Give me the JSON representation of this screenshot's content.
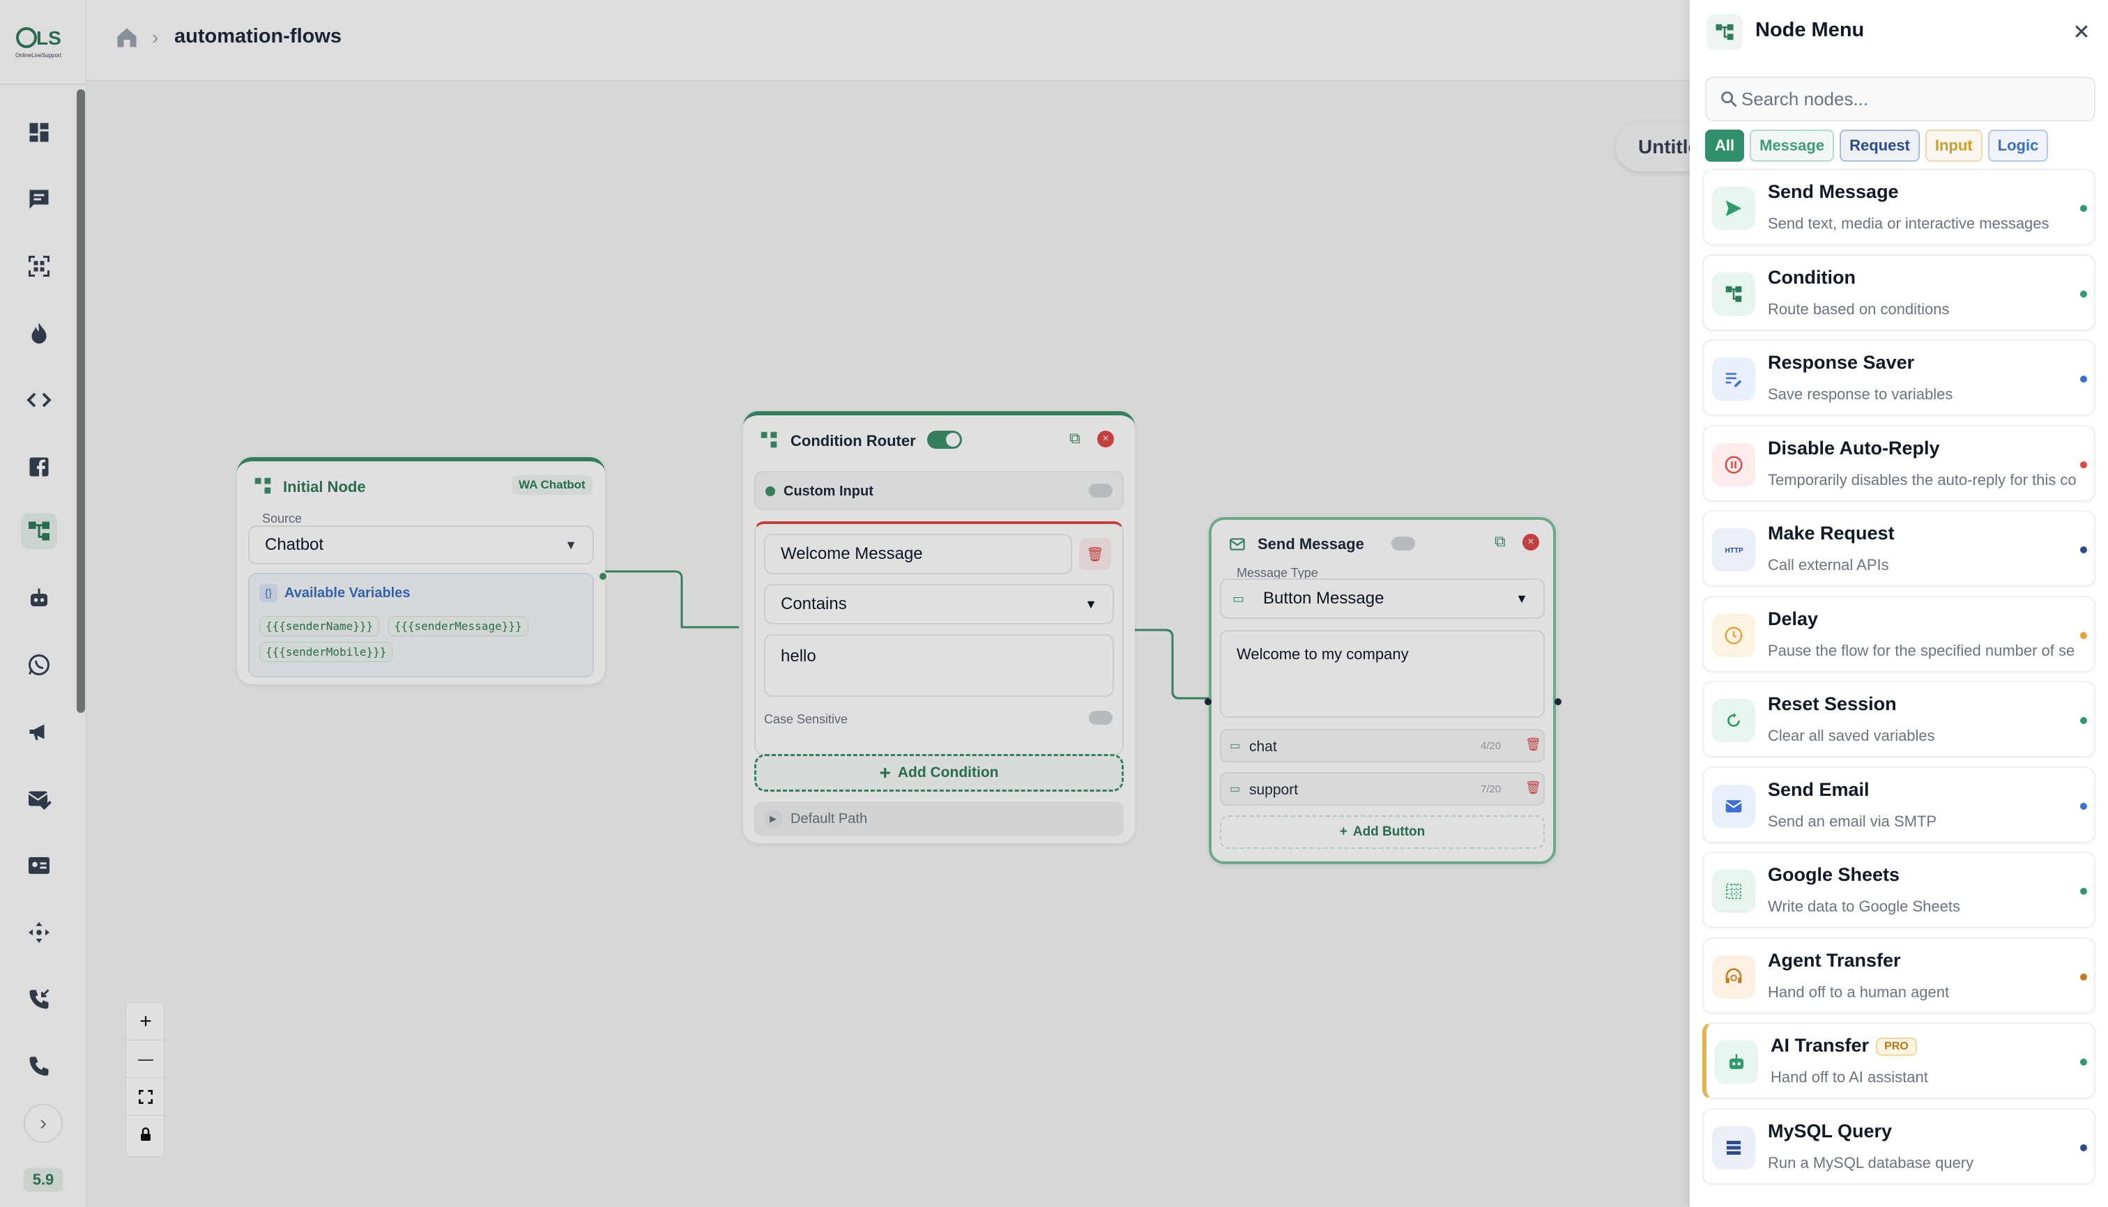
{
  "app": {
    "version": "5.9",
    "logo_text": "OLS",
    "logo_subtext": "OnlineLiveSupport"
  },
  "breadcrumb": {
    "current": "automation-flows"
  },
  "flow": {
    "name": "Untitled"
  },
  "canvas": {
    "initial_node": {
      "title": "Initial Node",
      "badge": "WA Chatbot",
      "source_label": "Source",
      "source_value": "Chatbot",
      "variables_title": "Available Variables",
      "variables": [
        "{{{senderName}}}",
        "{{{senderMessage}}}",
        "{{{senderMobile}}}"
      ]
    },
    "condition_router": {
      "title": "Condition Router",
      "custom_input_label": "Custom Input",
      "condition_field": "Welcome Message",
      "operator": "Contains",
      "value": "hello",
      "case_sensitive_label": "Case Sensitive",
      "add_condition_label": "Add Condition",
      "default_path_label": "Default Path"
    },
    "send_message": {
      "title": "Send Message",
      "message_type_label": "Message Type",
      "message_type_value": "Button Message",
      "message_text": "Welcome to my company",
      "buttons": [
        {
          "label": "chat",
          "count": "4/20"
        },
        {
          "label": "support",
          "count": "7/20"
        }
      ],
      "add_button_label": "Add Button"
    }
  },
  "zoom_controls": {
    "zoom_in": "+",
    "zoom_out": "—"
  },
  "node_menu": {
    "title": "Node Menu",
    "search_placeholder": "Search nodes...",
    "filters": [
      {
        "label": "All",
        "color": "#2f8f6a"
      },
      {
        "label": "Message",
        "color": "#3f9c76"
      },
      {
        "label": "Request",
        "color": "#2b4a8f"
      },
      {
        "label": "Input",
        "color": "#d19a2c"
      },
      {
        "label": "Logic",
        "color": "#3b6fc4"
      }
    ],
    "items": [
      {
        "title": "Send Message",
        "desc": "Send text, media or interactive messages",
        "icon": "send-icon",
        "dot": "#2f9a6a"
      },
      {
        "title": "Condition",
        "desc": "Route based on conditions",
        "icon": "branch-icon",
        "dot": "#2f9a6a"
      },
      {
        "title": "Response Saver",
        "desc": "Save response to variables",
        "icon": "edit-list-icon",
        "dot": "#3b6fd4"
      },
      {
        "title": "Disable Auto-Reply",
        "desc": "Temporarily disables the auto-reply for this co",
        "icon": "pause-icon",
        "dot": "#e04848"
      },
      {
        "title": "Make Request",
        "desc": "Call external APIs",
        "icon": "http-icon",
        "dot": "#2b4a8f"
      },
      {
        "title": "Delay",
        "desc": "Pause the flow for the specified number of se",
        "icon": "clock-icon",
        "dot": "#e6a23c"
      },
      {
        "title": "Reset Session",
        "desc": "Clear all saved variables",
        "icon": "reset-icon",
        "dot": "#2f9a6a"
      },
      {
        "title": "Send Email",
        "desc": "Send an email via SMTP",
        "icon": "mail-icon",
        "dot": "#3b6fd4"
      },
      {
        "title": "Google Sheets",
        "desc": "Write data to Google Sheets",
        "icon": "sheet-icon",
        "dot": "#2f9a6a"
      },
      {
        "title": "Agent Transfer",
        "desc": "Hand off to a human agent",
        "icon": "headset-icon",
        "dot": "#c47a1c"
      },
      {
        "title": "AI Transfer",
        "badge": "PRO",
        "desc": "Hand off to AI assistant",
        "icon": "robot-icon",
        "dot": "#2f9a6a"
      },
      {
        "title": "MySQL Query",
        "desc": "Run a MySQL database query",
        "icon": "database-icon",
        "dot": "#2b4a8f"
      }
    ]
  }
}
